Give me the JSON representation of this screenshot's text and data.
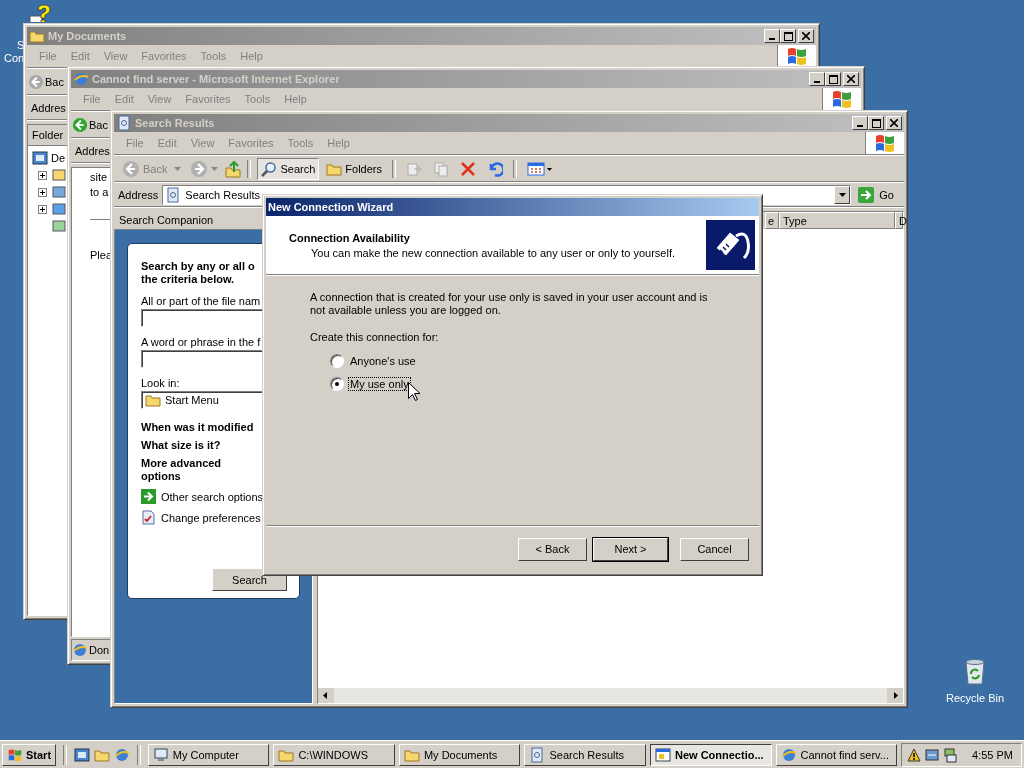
{
  "desktop_icons": [
    {
      "label_lines": [
        "S",
        "Con"
      ]
    },
    {
      "label_lines": [
        "Recycle Bin"
      ]
    }
  ],
  "my_documents_window": {
    "title": "My Documents",
    "active": false,
    "menu": [
      "File",
      "Edit",
      "View",
      "Favorites",
      "Tools",
      "Help"
    ],
    "back_label": "Bac",
    "address_label": "Addres",
    "folders_label": "Folder",
    "tree_root": "De",
    "tree_children": [
      {
        "expandable": true,
        "expanded": false
      },
      {
        "expandable": true,
        "expanded": false
      },
      {
        "expandable": true,
        "expanded": false
      },
      {
        "expandable": false
      }
    ]
  },
  "ie_window": {
    "title": "Cannot find server - Microsoft Internet Explorer",
    "active": false,
    "menu": [
      "File",
      "Edit",
      "View",
      "Favorites",
      "Tools",
      "Help"
    ],
    "back_label": "Bac",
    "address_label": "Addres",
    "page_lines": [
      "site",
      "to a"
    ],
    "page_text": "Plea",
    "status": "Don"
  },
  "search_window": {
    "title": "Search Results",
    "active": false,
    "menu": [
      "File",
      "Edit",
      "View",
      "Favorites",
      "Tools",
      "Help"
    ],
    "toolbar": {
      "back": {
        "label": "Back",
        "disabled": true
      },
      "search": {
        "label": "Search",
        "selected": true
      },
      "folders": {
        "label": "Folders",
        "selected": false
      }
    },
    "address": {
      "label": "Address",
      "value": "Search Results",
      "go": "Go"
    },
    "companion": {
      "title": "Search Companion",
      "heading": "Search by any or all o",
      "heading_2": "the criteria below.",
      "file_name_label": "All or part of the file nam",
      "word_label": "A word or phrase in the f",
      "look_in_label": "Look in:",
      "look_in_value": "Start Menu",
      "sections": [
        "When was it modified",
        "What size is it?",
        "More advanced options"
      ],
      "links": [
        "Other search options",
        "Change preferences"
      ],
      "search_button": "Search"
    },
    "columns": [
      "e",
      "Type",
      "D"
    ]
  },
  "wizard": {
    "title": "New Connection Wizard",
    "active": true,
    "header_title": "Connection Availability",
    "header_subtitle": "You can make the new connection available to any user or only to yourself.",
    "paragraph": "A connection that is created for your use only is saved in your user account and is not available unless you are logged on.",
    "prompt": "Create this connection for:",
    "options": [
      {
        "label": "Anyone's use",
        "selected": false
      },
      {
        "label": "My use only",
        "selected": true
      }
    ],
    "buttons": [
      {
        "label": "< Back",
        "default": false
      },
      {
        "label": "Next >",
        "default": true
      },
      {
        "label": "Cancel",
        "default": false
      }
    ]
  },
  "taskbar": {
    "start": "Start",
    "tasks": [
      {
        "label": "My Computer",
        "selected": false
      },
      {
        "label": "C:\\WINDOWS",
        "selected": false
      },
      {
        "label": "My Documents",
        "selected": false
      },
      {
        "label": "Search Results",
        "selected": false
      },
      {
        "label": "New Connectio...",
        "selected": true
      },
      {
        "label": "Cannot find serv...",
        "selected": false
      }
    ],
    "clock": "4:55 PM"
  }
}
